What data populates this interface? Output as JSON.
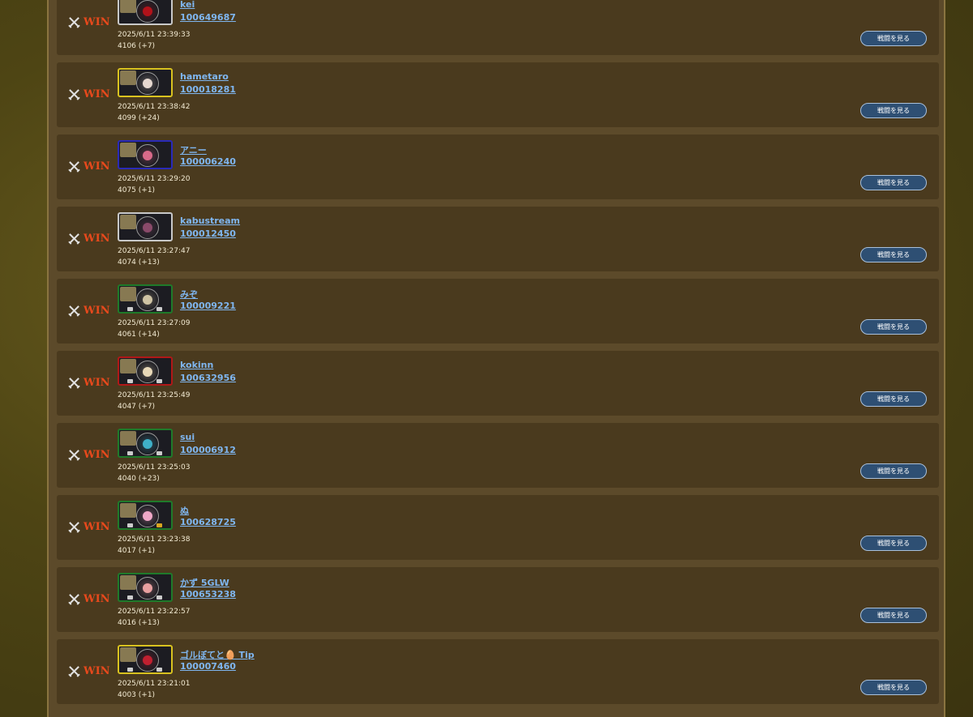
{
  "matches": [
    {
      "result": "WIN",
      "player_name": "kei",
      "player_id": "100649687",
      "timestamp": "2025/6/11 23:39:33",
      "rating": "4106 (+7)",
      "watch_label": "戦闘を見る",
      "frame_color": "#c8c8c8",
      "orb_color": "#b3121a"
    },
    {
      "result": "WIN",
      "player_name": "hametaro",
      "player_id": "100018281",
      "timestamp": "2025/6/11 23:38:42",
      "rating": "4099 (+24)",
      "watch_label": "戦闘を見る",
      "frame_color": "#d9c21f",
      "orb_color": "#e6d8d0"
    },
    {
      "result": "WIN",
      "player_name": "アニー",
      "player_id": "100006240",
      "timestamp": "2025/6/11 23:29:20",
      "rating": "4075 (+1)",
      "watch_label": "戦闘を見る",
      "frame_color": "#2a2ab8",
      "orb_color": "#d86a8a"
    },
    {
      "result": "WIN",
      "player_name": "kabustream",
      "player_id": "100012450",
      "timestamp": "2025/6/11 23:27:47",
      "rating": "4074 (+13)",
      "watch_label": "戦闘を見る",
      "frame_color": "#c8c8c8",
      "orb_color": "#8a4a6a"
    },
    {
      "result": "WIN",
      "player_name": "みぞ",
      "player_id": "100009221",
      "timestamp": "2025/6/11 23:27:09",
      "rating": "4061 (+14)",
      "watch_label": "戦闘を見る",
      "frame_color": "#1f7a2a",
      "orb_color": "#cfc4a4"
    },
    {
      "result": "WIN",
      "player_name": "kokinn",
      "player_id": "100632956",
      "timestamp": "2025/6/11 23:25:49",
      "rating": "4047 (+7)",
      "watch_label": "戦闘を見る",
      "frame_color": "#b01818",
      "orb_color": "#e8d9b8"
    },
    {
      "result": "WIN",
      "player_name": "sui",
      "player_id": "100006912",
      "timestamp": "2025/6/11 23:25:03",
      "rating": "4040 (+23)",
      "watch_label": "戦闘を見る",
      "frame_color": "#1f7a2a",
      "orb_color": "#3fb0c8"
    },
    {
      "result": "WIN",
      "player_name": "ぬ",
      "player_id": "100628725",
      "timestamp": "2025/6/11 23:23:38",
      "rating": "4017 (+1)",
      "watch_label": "戦闘を見る",
      "frame_color": "#1f7a2a",
      "orb_color": "#f0a8c8"
    },
    {
      "result": "WIN",
      "player_name": "かず 5GLW",
      "player_id": "100653238",
      "timestamp": "2025/6/11 23:22:57",
      "rating": "4016 (+13)",
      "watch_label": "戦闘を見る",
      "frame_color": "#1f7a2a",
      "orb_color": "#e8a0a0"
    },
    {
      "result": "WIN",
      "player_name": "ゴルぼてと🥚 Tip",
      "player_id": "100007460",
      "timestamp": "2025/6/11 23:21:01",
      "rating": "4003 (+1)",
      "watch_label": "戦闘を見る",
      "frame_color": "#d9c21f",
      "orb_color": "#c02030"
    }
  ]
}
